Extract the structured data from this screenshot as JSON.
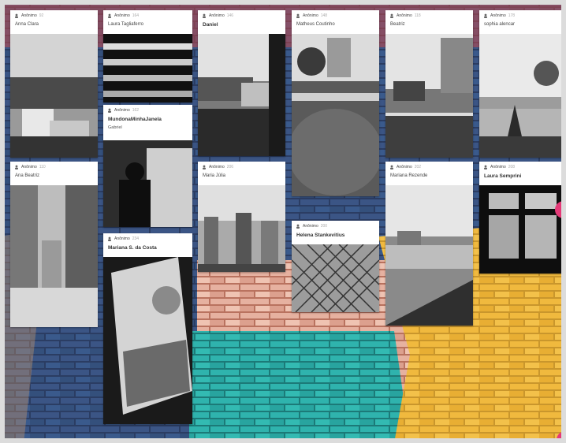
{
  "app": {
    "author_label": "Anônimo"
  },
  "colors": {
    "accent": "#e53a78",
    "card": "#ffffff",
    "meta": "#aaaaaa"
  },
  "cards": [
    {
      "id": "anna",
      "name": "Anna Clara",
      "num": "92",
      "bold": false
    },
    {
      "id": "laura-t",
      "name": "Laura Tagliaferro",
      "num": "164",
      "bold": false
    },
    {
      "id": "daniel",
      "name": "Daniel",
      "num": "146",
      "bold": true
    },
    {
      "id": "matheus",
      "name": "Matheus Coutinho",
      "num": "148",
      "bold": false
    },
    {
      "id": "beatriz",
      "name": "Beatriz",
      "num": "118",
      "bold": false
    },
    {
      "id": "sophia",
      "name": "sophia alencar",
      "num": "178",
      "bold": false
    },
    {
      "id": "mundona",
      "name": "MundonaMinhaJanela",
      "sub": "Gabriel",
      "num": "162",
      "bold": true
    },
    {
      "id": "ana-b",
      "name": "Ana Beatriz",
      "num": "110",
      "bold": false
    },
    {
      "id": "maria-j",
      "name": "Maria Júlia",
      "num": "206",
      "bold": false
    },
    {
      "id": "mariana-r",
      "name": "Mariana Rezende",
      "num": "202",
      "bold": false
    },
    {
      "id": "laura-s",
      "name": "Laura Semprini",
      "num": "208",
      "bold": true
    },
    {
      "id": "helena",
      "name": "Helena Stankevitius",
      "num": "200",
      "bold": true
    },
    {
      "id": "mariana-s",
      "name": "Mariana S. da Costa",
      "num": "234",
      "bold": true
    }
  ]
}
